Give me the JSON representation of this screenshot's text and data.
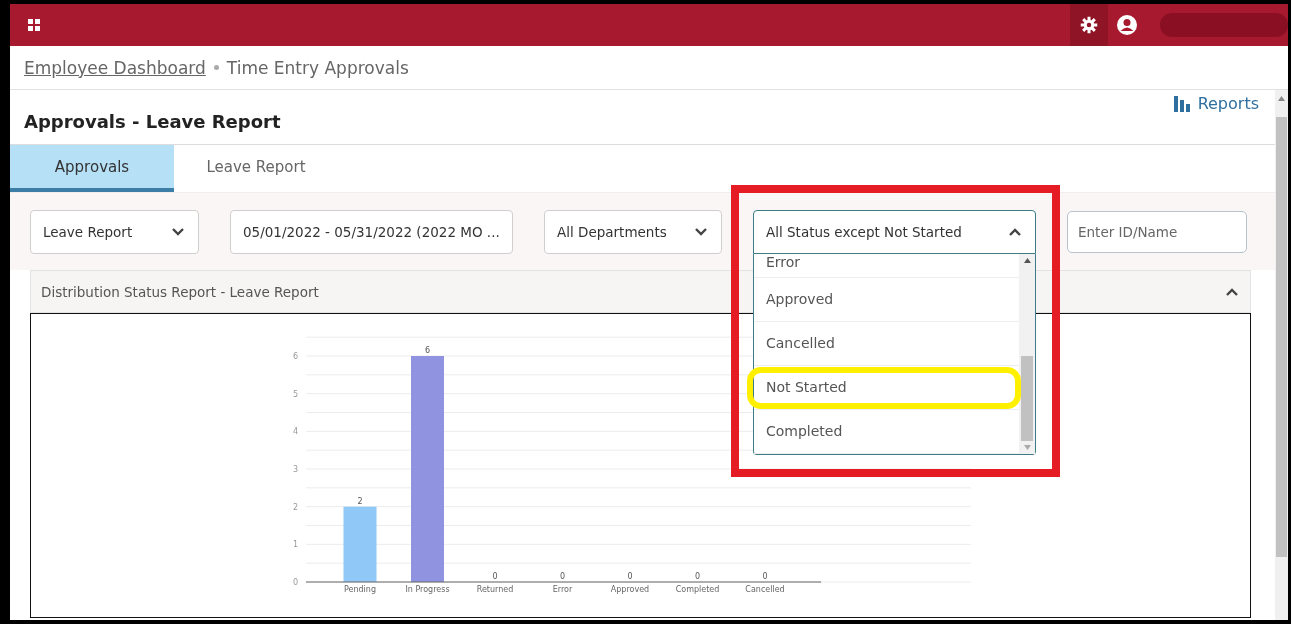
{
  "breadcrumb": [
    {
      "label": "Employee Dashboard",
      "kind": "link"
    },
    {
      "label": "Time Entry Approvals",
      "kind": "current"
    }
  ],
  "page_title": "Approvals - Leave Report",
  "reports_link": "Reports",
  "tabs": [
    {
      "label": "Approvals",
      "selected": true
    },
    {
      "label": "Leave Report",
      "selected": false
    }
  ],
  "filters": [
    {
      "kind": "select",
      "value": "Leave Report",
      "expanded": false,
      "outlined": false
    },
    {
      "kind": "select",
      "value": "05/01/2022 - 05/31/2022 (2022 MO ...",
      "expanded": false,
      "outlined": false
    },
    {
      "kind": "select",
      "value": "All Departments",
      "expanded": false,
      "outlined": false
    },
    {
      "kind": "select",
      "value": "All Status except Not Started",
      "expanded": true,
      "outlined": true
    },
    {
      "kind": "input",
      "placeholder": "Enter ID/Name"
    }
  ],
  "status_options": [
    {
      "label": "Error",
      "highlighted": false
    },
    {
      "label": "Approved",
      "highlighted": false
    },
    {
      "label": "Cancelled",
      "highlighted": false
    },
    {
      "label": "Not Started",
      "highlighted": true
    },
    {
      "label": "Completed",
      "highlighted": false
    }
  ],
  "panel": {
    "title": "Distribution Status Report - Leave Report",
    "expanded": true,
    "chart_data": {
      "type": "bar",
      "categories": [
        "Pending",
        "In Progress",
        "Returned",
        "Error",
        "Approved",
        "Completed",
        "Cancelled"
      ],
      "series": [
        {
          "color": "#90c8f8",
          "values": [
            2,
            null,
            0,
            0,
            0,
            0,
            0
          ]
        },
        {
          "color": "#9094e0",
          "values": [
            null,
            6,
            null,
            null,
            null,
            null,
            null
          ]
        }
      ],
      "grid": true,
      "ylim": [
        0,
        6
      ],
      "yticks": [
        0,
        1,
        2,
        3,
        4,
        5,
        6
      ],
      "data_labels": true
    }
  }
}
